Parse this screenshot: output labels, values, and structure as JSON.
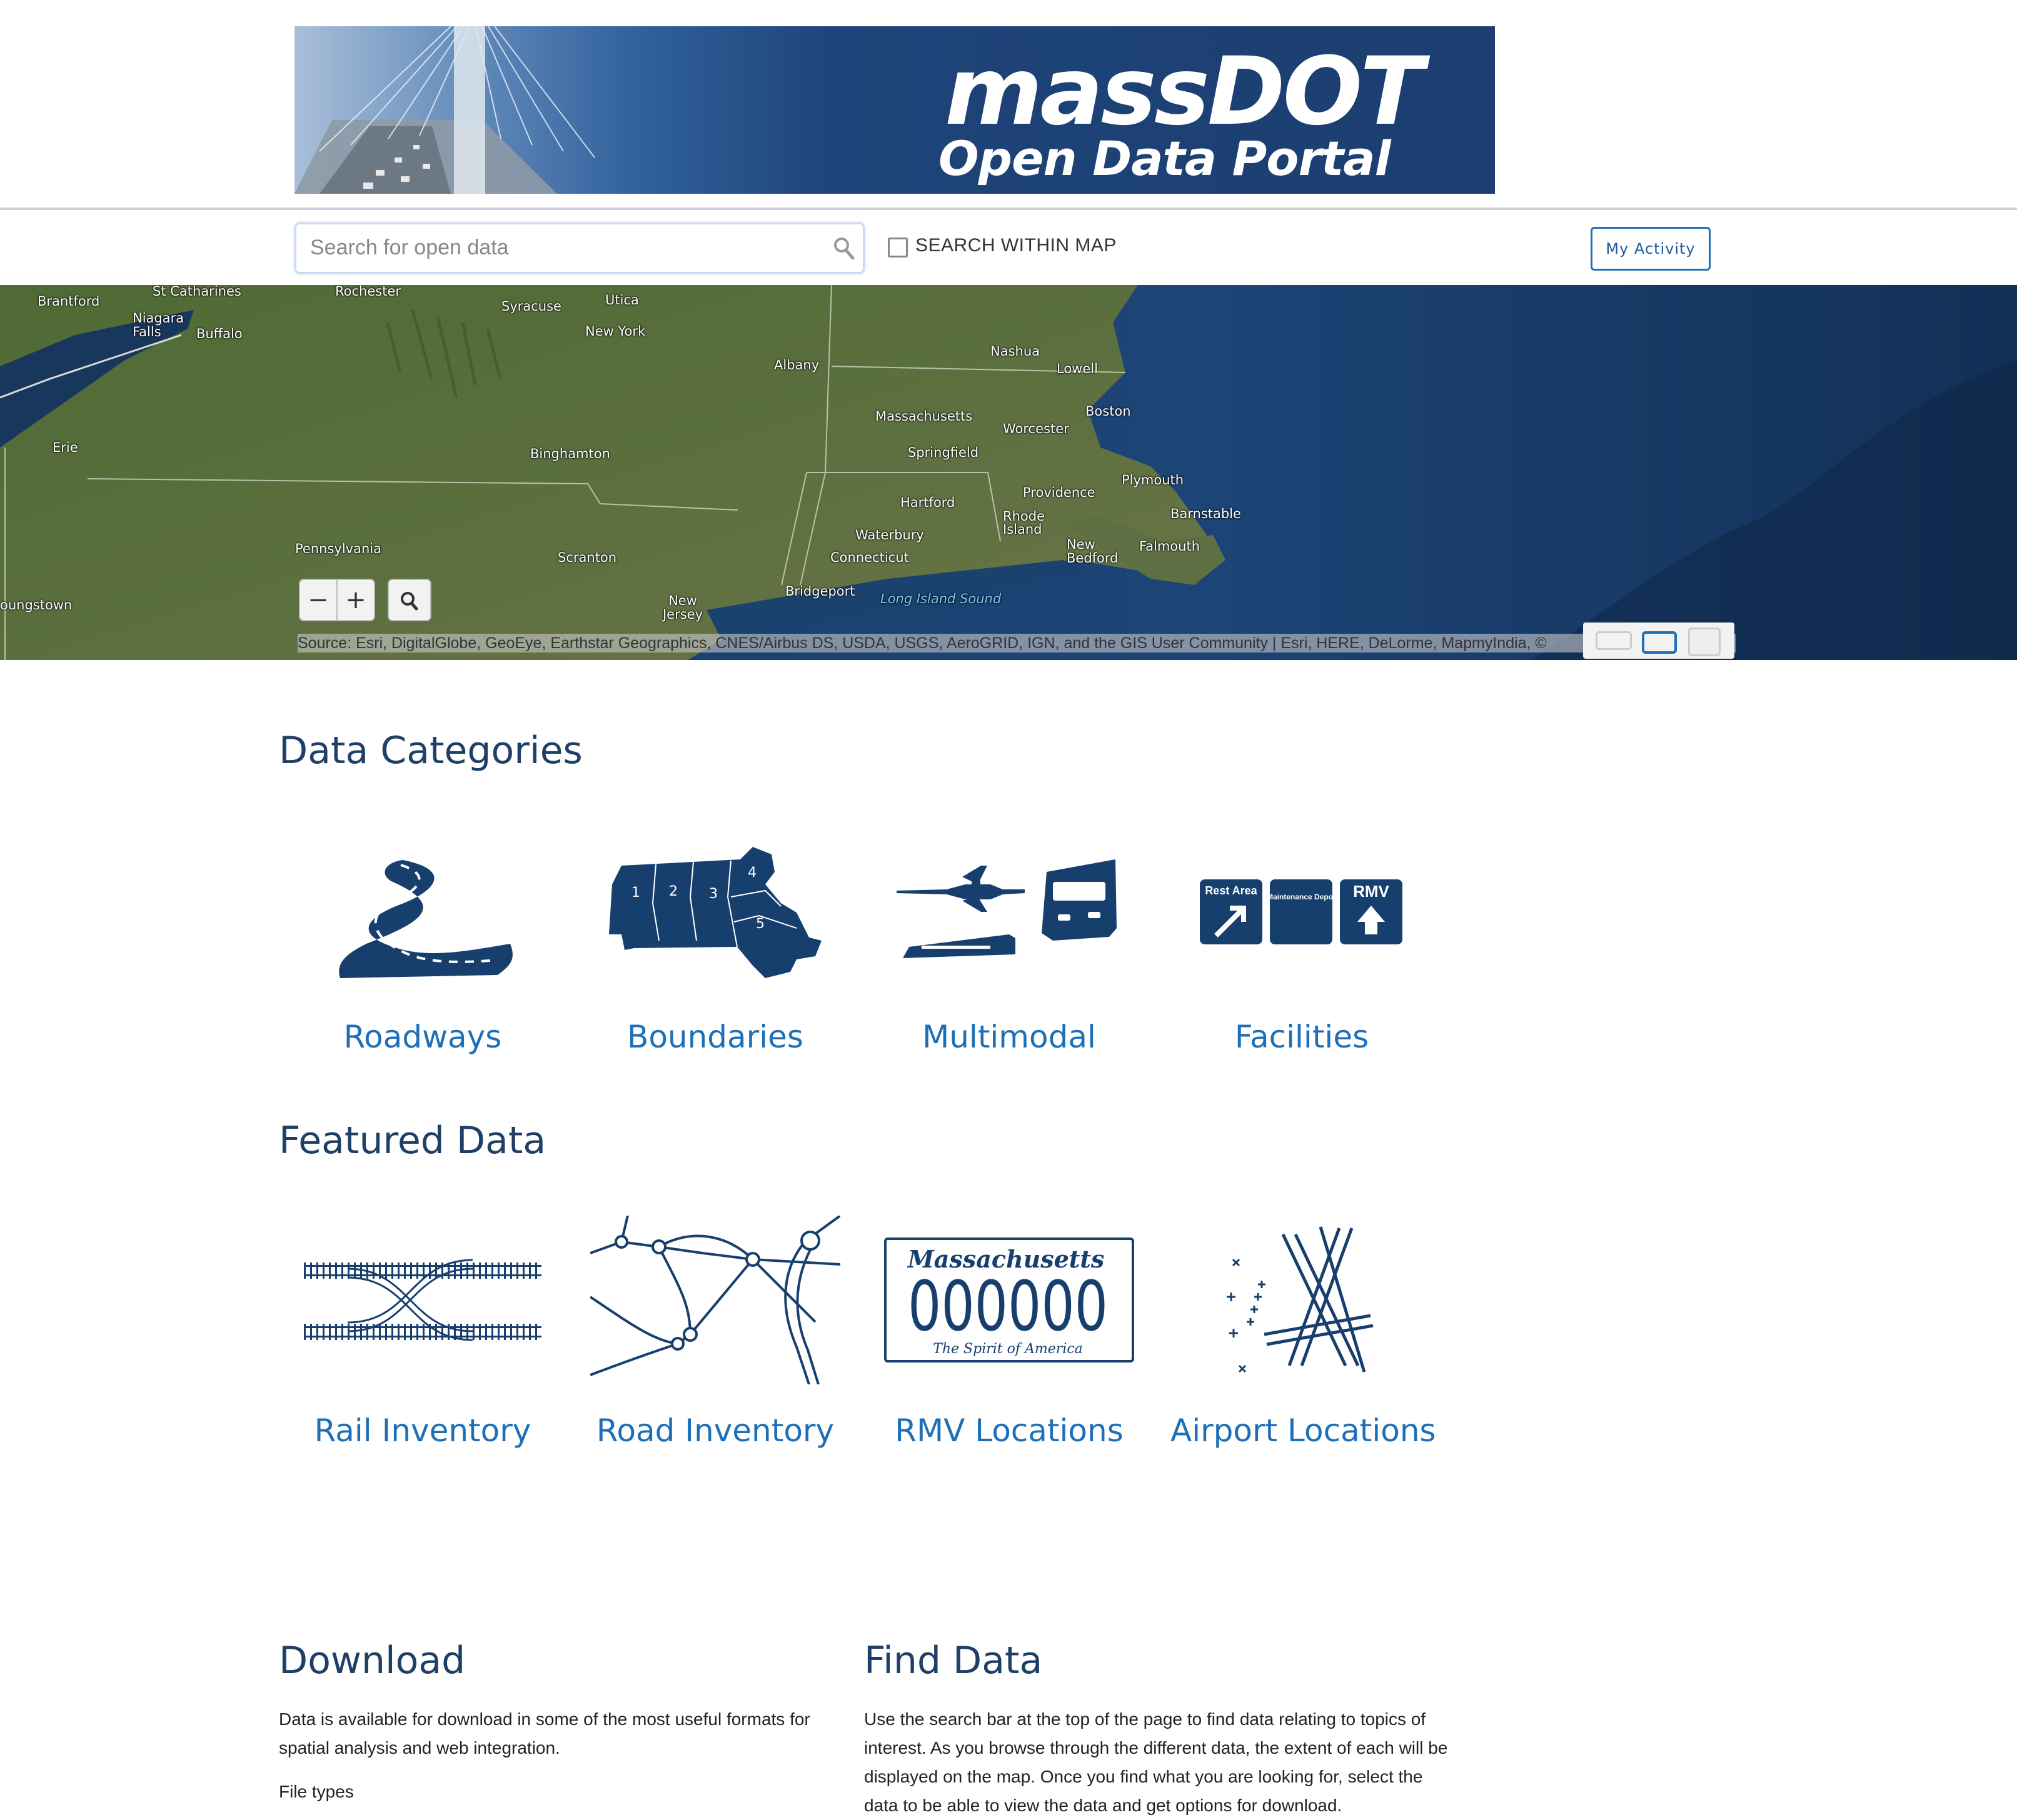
{
  "header": {
    "brand_line1": "massDOT",
    "brand_line2": "Open Data Portal"
  },
  "search": {
    "placeholder": "Search for open data",
    "within_map_label": "SEARCH WITHIN MAP",
    "my_activity_label": "My Activity"
  },
  "map": {
    "labels": [
      {
        "text": "Brantford",
        "kind": "city"
      },
      {
        "text": "St Catharines",
        "kind": "city"
      },
      {
        "text": "Niagara Falls",
        "kind": "city"
      },
      {
        "text": "Buffalo",
        "kind": "city"
      },
      {
        "text": "Rochester",
        "kind": "city"
      },
      {
        "text": "Syracuse",
        "kind": "city"
      },
      {
        "text": "Utica",
        "kind": "city"
      },
      {
        "text": "New York",
        "kind": "region"
      },
      {
        "text": "Albany",
        "kind": "city"
      },
      {
        "text": "Nashua",
        "kind": "city"
      },
      {
        "text": "Lowell",
        "kind": "city"
      },
      {
        "text": "Massachusetts",
        "kind": "region"
      },
      {
        "text": "Worcester",
        "kind": "city"
      },
      {
        "text": "Boston",
        "kind": "city"
      },
      {
        "text": "Springfield",
        "kind": "city"
      },
      {
        "text": "Erie",
        "kind": "city"
      },
      {
        "text": "Binghamton",
        "kind": "city"
      },
      {
        "text": "Hartford",
        "kind": "city"
      },
      {
        "text": "Providence",
        "kind": "city"
      },
      {
        "text": "Plymouth",
        "kind": "city"
      },
      {
        "text": "Rhode Island",
        "kind": "region"
      },
      {
        "text": "Barnstable",
        "kind": "city"
      },
      {
        "text": "Waterbury",
        "kind": "city"
      },
      {
        "text": "New Bedford",
        "kind": "city"
      },
      {
        "text": "Falmouth",
        "kind": "city"
      },
      {
        "text": "Pennsylvania",
        "kind": "region"
      },
      {
        "text": "Scranton",
        "kind": "city"
      },
      {
        "text": "Connecticut",
        "kind": "region"
      },
      {
        "text": "Bridgeport",
        "kind": "city"
      },
      {
        "text": "Long Island Sound",
        "kind": "water"
      },
      {
        "text": "New Jersey",
        "kind": "region"
      },
      {
        "text": "oungstown",
        "kind": "city"
      }
    ],
    "zoom_out": "−",
    "zoom_in": "+",
    "attribution": "Source: Esri, DigitalGlobe, GeoEye, Earthstar Geographics, CNES/Airbus DS, USDA, USGS, AeroGRID, IGN, and the GIS User Community |  Esri, HERE, DeLorme, MapmyIndia, ©"
  },
  "categories": {
    "title": "Data Categories",
    "items": [
      {
        "label": "Roadways",
        "icon": "road-icon"
      },
      {
        "label": "Boundaries",
        "icon": "massachusetts-map-icon"
      },
      {
        "label": "Multimodal",
        "icon": "transport-icon"
      },
      {
        "label": "Facilities",
        "icon": "highway-signs-icon"
      }
    ],
    "boundaries_districts": [
      "1",
      "2",
      "3",
      "4",
      "5"
    ],
    "facility_signs": [
      "Rest Area",
      "Maintenance Depot",
      "RMV"
    ]
  },
  "featured": {
    "title": "Featured Data",
    "items": [
      {
        "label": "Rail Inventory",
        "icon": "rail-tracks-icon"
      },
      {
        "label": "Road Inventory",
        "icon": "road-network-icon"
      },
      {
        "label": "RMV Locations",
        "icon": "license-plate-icon"
      },
      {
        "label": "Airport Locations",
        "icon": "airport-runway-icon"
      }
    ],
    "plate": {
      "state": "Massachusetts",
      "number": "000000",
      "slogan": "The Spirit of America"
    }
  },
  "download": {
    "title": "Download",
    "text": "Data is available for download in some of the most useful formats for spatial analysis and web integration.",
    "file_types_label": "File types"
  },
  "find_data": {
    "title": "Find Data",
    "text": "Use the search bar at the top of the page to find data relating to topics of interest. As you browse through the different data, the extent of each will be displayed on the map. Once you find what you are looking for, select the data to be able to view the data and get options for download."
  },
  "colors": {
    "brand_navy": "#1c3e70",
    "link_blue": "#1d6fb8",
    "heading_navy": "#1f3f66",
    "icon_navy": "#173f6e"
  }
}
